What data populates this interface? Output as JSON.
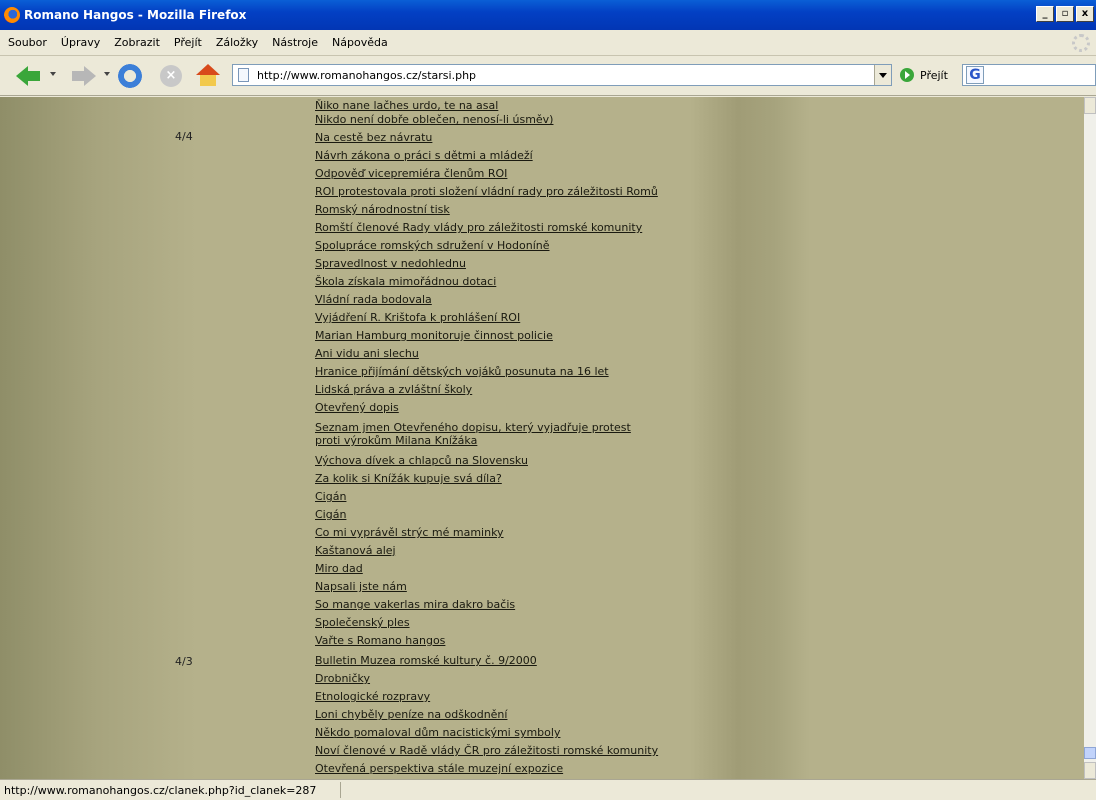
{
  "window": {
    "title": "Romano Hangos - Mozilla Firefox"
  },
  "menu": [
    "Soubor",
    "Úpravy",
    "Zobrazit",
    "Přejít",
    "Záložky",
    "Nástroje",
    "Nápověda"
  ],
  "navbar": {
    "url": "http://www.romanohangos.cz/starsi.php",
    "go_label": "Přejít",
    "stop_glyph": "×"
  },
  "sections": [
    {
      "label": "4/4"
    },
    {
      "label": "4/3"
    }
  ],
  "articles": [
    "Ňiko nane lačhes urdo, te na asal",
    "Nikdo není dobře oblečen, nenosí-li úsměv)",
    "Na cestě bez návratu",
    "Návrh zákona o práci s dětmi a mládeží",
    "Odpověď vicepremiéra členům ROI",
    "ROI protestovala proti složení vládní rady pro záležitosti Romů",
    "Romský národnostní tisk",
    "Romští členové Rady vlády pro záležitosti romské komunity",
    "Spolupráce romských sdružení v Hodoníně",
    "Spravedlnost v nedohlednu",
    "Škola získala mimořádnou dotaci",
    "Vládní rada bodovala",
    "Vyjádření R. Krištofa k prohlášení ROI",
    "Marian Hamburg monitoruje činnost policie",
    "Ani vidu ani slechu",
    "Hranice přijímání dětských vojáků posunuta na 16 let",
    "Lidská práva a zvláštní školy",
    "Otevřený dopis",
    "Seznam jmen Otevřeného dopisu, který vyjadřuje protest",
    "proti výrokům Milana Knížáka",
    "Výchova dívek a chlapců na Slovensku",
    "Za kolik si Knížák kupuje svá díla?",
    "Cigán",
    "Cigán",
    "Co mi vyprávěl strýc mé maminky",
    "Kaštanová alej",
    "Miro dad",
    "Napsali jste nám",
    "So mange vakerlas mira dakro bačis",
    "Společenský ples",
    "Vařte s Romano hangos",
    "Bulletin Muzea romské kultury č. 9/2000",
    "Drobničky",
    "Etnologické rozpravy",
    "Loni chyběly peníze na odškodnění",
    "Někdo pomaloval dům nacistickými symboly",
    "Noví členové v Radě vlády ČR pro záležitosti romské komunity",
    "Otevřená perspektiva stále muzejní expozice"
  ],
  "status": {
    "text": "http://www.romanohangos.cz/clanek.php?id_clanek=287"
  }
}
